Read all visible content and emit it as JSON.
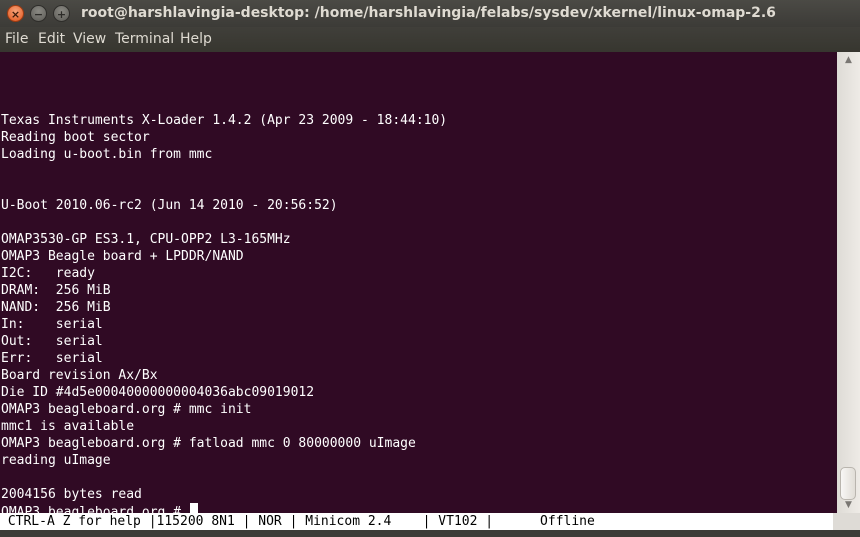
{
  "window": {
    "title": "root@harshlavingia-desktop: /home/harshlavingia/felabs/sysdev/xkernel/linux-omap-2.6",
    "buttons": {
      "close": "×",
      "minimize": "−",
      "maximize": "+"
    }
  },
  "menu": {
    "items": [
      "File",
      "Edit",
      "View",
      "Terminal",
      "Help"
    ]
  },
  "terminal": {
    "lines": [
      "",
      "",
      "",
      "Texas Instruments X-Loader 1.4.2 (Apr 23 2009 - 18:44:10)",
      "Reading boot sector",
      "Loading u-boot.bin from mmc",
      "",
      "",
      "U-Boot 2010.06-rc2 (Jun 14 2010 - 20:56:52)",
      "",
      "OMAP3530-GP ES3.1, CPU-OPP2 L3-165MHz",
      "OMAP3 Beagle board + LPDDR/NAND",
      "I2C:   ready",
      "DRAM:  256 MiB",
      "NAND:  256 MiB",
      "In:    serial",
      "Out:   serial",
      "Err:   serial",
      "Board revision Ax/Bx",
      "Die ID #4d5e00040000000004036abc09019012",
      "OMAP3 beagleboard.org # mmc init",
      "mmc1 is available",
      "OMAP3 beagleboard.org # fatload mmc 0 80000000 uImage",
      "reading uImage",
      "",
      "2004156 bytes read",
      "OMAP3 beagleboard.org # "
    ]
  },
  "status": {
    "text": " CTRL-A Z for help |115200 8N1 | NOR | Minicom 2.4    | VT102 |      Offline"
  },
  "scrollbar": {
    "up_arrow": "▲",
    "down_arrow": "▼"
  }
}
